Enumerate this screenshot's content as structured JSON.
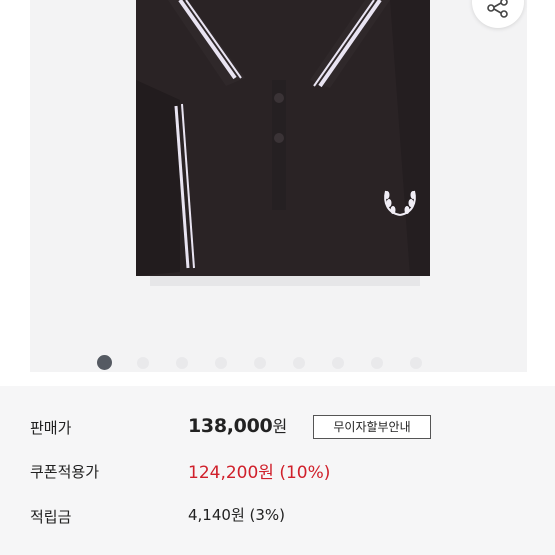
{
  "gallery": {
    "image_count": 9,
    "active_index": 0
  },
  "icons": {
    "share": "share-icon",
    "brand_logo": "laurel-wreath-icon"
  },
  "colors": {
    "shirt": "#2a2325",
    "tipping": "#e9e4f2",
    "price_red": "#d0202b",
    "panel_bg": "#f6f6f7"
  },
  "price": {
    "sale_label": "판매가",
    "sale_amount": "138,000",
    "sale_unit": "원",
    "interest_free_button": "무이자할부안내",
    "coupon_label": "쿠폰적용가",
    "coupon_value": "124,200원 (10%)",
    "points_label": "적립금",
    "points_value": "4,140원 (3%)"
  }
}
